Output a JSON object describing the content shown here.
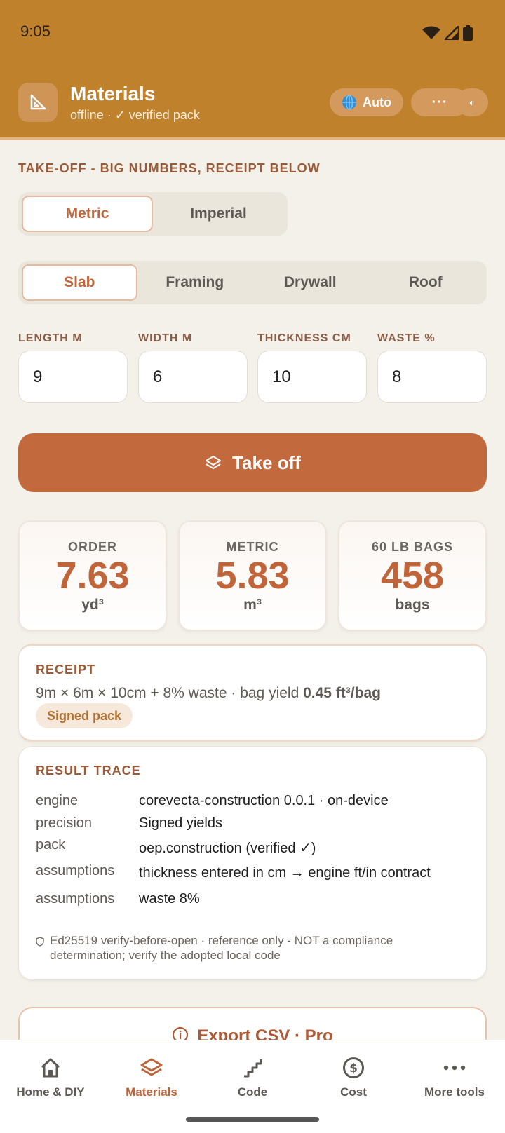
{
  "status": {
    "time": "9:05"
  },
  "app": {
    "title": "Materials",
    "subtitle": "offline · ✓ verified pack",
    "lang_button": "Auto",
    "more_button": "···",
    "theme_button": "◐"
  },
  "header": "TAKE-OFF - BIG NUMBERS, RECEIPT BELOW",
  "units": {
    "options": [
      "Metric",
      "Imperial"
    ],
    "selected": "Metric"
  },
  "kinds": {
    "options": [
      "Slab",
      "Framing",
      "Drywall",
      "Roof"
    ],
    "selected": "Slab"
  },
  "fields": [
    {
      "label": "LENGTH M",
      "value": "9"
    },
    {
      "label": "WIDTH M",
      "value": "6"
    },
    {
      "label": "THICKNESS CM",
      "value": "10"
    },
    {
      "label": "WASTE %",
      "value": "8"
    }
  ],
  "takeoff_button": "Take off",
  "stats": [
    {
      "label": "ORDER",
      "value": "7.63",
      "unit": "yd³"
    },
    {
      "label": "METRIC",
      "value": "5.83",
      "unit": "m³"
    },
    {
      "label": "60 LB BAGS",
      "value": "458",
      "unit": "bags"
    }
  ],
  "receipt": {
    "title": "RECEIPT",
    "line": "9m × 6m × 10cm + 8% waste · bag yield ",
    "line_bold": "0.45 ft³/bag",
    "badge": "Signed pack"
  },
  "trace": {
    "title": "RESULT TRACE",
    "rows": [
      {
        "key": "engine",
        "value": "corevecta-construction 0.0.1 · on-device"
      },
      {
        "key": "precision",
        "value": "Signed yields"
      },
      {
        "key": "pack",
        "value": "oep.construction (verified ✓)"
      },
      {
        "key": "assumptions",
        "value": "thickness entered in cm → engine ft/in contract"
      },
      {
        "key": "assumptions",
        "value": "waste 8%"
      }
    ],
    "note": "Ed25519 verify-before-open · reference only - NOT a compliance determination; verify the adopted local code"
  },
  "export_button": "Export CSV · Pro",
  "nav": {
    "items": [
      {
        "label": "Home & DIY",
        "icon": "home-icon"
      },
      {
        "label": "Materials",
        "icon": "layers-icon"
      },
      {
        "label": "Code",
        "icon": "stairs-icon"
      },
      {
        "label": "Cost",
        "icon": "dollar-icon"
      },
      {
        "label": "More tools",
        "icon": "dots-icon"
      }
    ],
    "active": "Materials"
  },
  "colors": {
    "accent": "#c2693d",
    "header_bg": "#c0812c",
    "page_bg": "#f4f1ea"
  }
}
